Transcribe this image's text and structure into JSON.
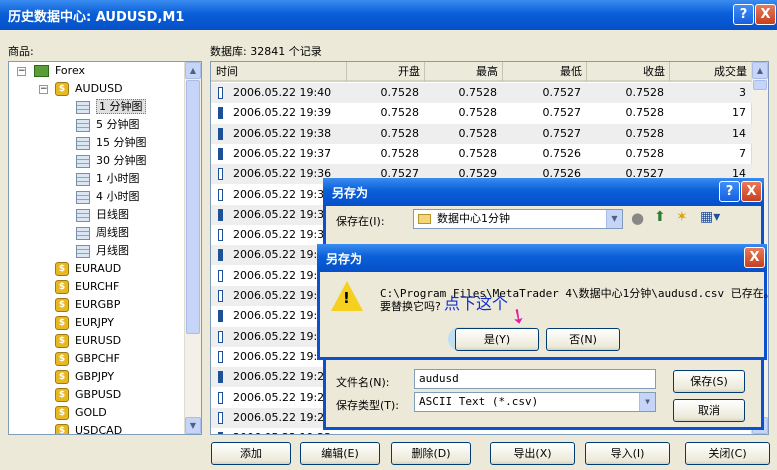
{
  "window": {
    "title": "历史数据中心: AUDUSD,M1",
    "help": "?",
    "close": "X"
  },
  "symbols_label": "商品:",
  "database_label": "数据库: 32841 个记录",
  "tree": {
    "root": "Forex",
    "symbol": "AUDUSD",
    "timeframes": [
      "1 分钟图",
      "5 分钟图",
      "15 分钟图",
      "30 分钟图",
      "1 小时图",
      "4 小时图",
      "日线图",
      "周线图",
      "月线图"
    ],
    "others": [
      "EURAUD",
      "EURCHF",
      "EURGBP",
      "EURJPY",
      "EURUSD",
      "GBPCHF",
      "GBPJPY",
      "GBPUSD",
      "GOLD",
      "USDCAD"
    ]
  },
  "table": {
    "headers": [
      "时间",
      "开盘",
      "最高",
      "最低",
      "收盘",
      "成交量"
    ],
    "rows": [
      {
        "t": "2006.05.22 19:40",
        "o": "0.7528",
        "h": "0.7528",
        "l": "0.7527",
        "c": "0.7528",
        "v": "3",
        "f": false,
        "s": true
      },
      {
        "t": "2006.05.22 19:39",
        "o": "0.7528",
        "h": "0.7528",
        "l": "0.7527",
        "c": "0.7528",
        "v": "17",
        "f": true,
        "s": false
      },
      {
        "t": "2006.05.22 19:38",
        "o": "0.7528",
        "h": "0.7528",
        "l": "0.7527",
        "c": "0.7528",
        "v": "14",
        "f": true,
        "s": true
      },
      {
        "t": "2006.05.22 19:37",
        "o": "0.7528",
        "h": "0.7528",
        "l": "0.7526",
        "c": "0.7528",
        "v": "7",
        "f": true,
        "s": false
      },
      {
        "t": "2006.05.22 19:36",
        "o": "0.7527",
        "h": "0.7529",
        "l": "0.7526",
        "c": "0.7527",
        "v": "14",
        "f": false,
        "s": true
      },
      {
        "t": "2006.05.22 19:35",
        "f": false,
        "s": false
      },
      {
        "t": "2006.05.22 19:34",
        "f": true,
        "s": true
      },
      {
        "t": "2006.05.22 19:33",
        "f": false,
        "s": false
      },
      {
        "t": "2006.05.22 19:32",
        "f": true,
        "s": true
      },
      {
        "t": "2006.05.22 19:31",
        "f": false,
        "s": false
      },
      {
        "t": "2006.05.22 19:30",
        "f": false,
        "s": true
      },
      {
        "t": "2006.05.22 19:29",
        "f": true,
        "s": false
      },
      {
        "t": "2006.05.22 19:28",
        "f": false,
        "s": true
      },
      {
        "t": "2006.05.22 19:27",
        "f": false,
        "s": false
      },
      {
        "t": "2006.05.22 19:26",
        "f": true,
        "s": true
      },
      {
        "t": "2006.05.22 19:25",
        "f": false,
        "s": false
      },
      {
        "t": "2006.05.22 19:24",
        "f": false,
        "s": true
      },
      {
        "t": "2006.05.22 19:23",
        "f": true,
        "s": false
      }
    ]
  },
  "buttons": {
    "add": "添加",
    "edit": "编辑(E)",
    "delete": "删除(D)",
    "export": "导出(X)",
    "import": "导入(I)",
    "close": "关闭(C)"
  },
  "save_dialog": {
    "title": "另存为",
    "save_in_label": "保存在(I):",
    "save_in_value": "数据中心1分钟",
    "filename_label": "文件名(N):",
    "filename_value": "audusd",
    "filetype_label": "保存类型(T):",
    "filetype_value": "ASCII Text (*.csv)",
    "save": "保存(S)",
    "cancel": "取消"
  },
  "confirm_dialog": {
    "title": "另存为",
    "message_line1": "C:\\Program Files\\MetaTrader 4\\数据中心1分钟\\audusd.csv 已存在。",
    "message_line2": "要替换它吗?",
    "yes": "是(Y)",
    "no": "否(N)"
  },
  "annotation": "点下这个"
}
